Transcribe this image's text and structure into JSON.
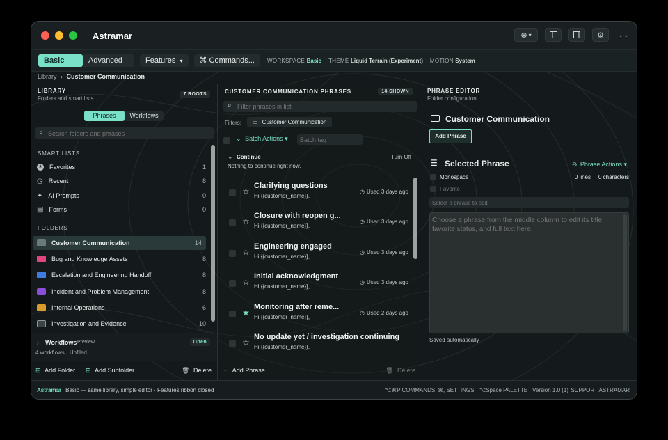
{
  "app": {
    "title": "Astramar"
  },
  "colors": {
    "accent": "#7be0c8",
    "window_bg": "#141a1b",
    "favorite_star": "#7be0c8"
  },
  "ribbon": {
    "modes": [
      "Basic",
      "Advanced"
    ],
    "features_label": "Features",
    "commands_label": "⌘ Commands...",
    "workspace_key": "WORKSPACE",
    "workspace_val": "Basic",
    "theme_key": "THEME",
    "theme_val": "Liquid Terrain (Experiment)",
    "motion_key": "MOTION",
    "motion_val": "System"
  },
  "breadcrumb": {
    "root": "Library",
    "sep": "›",
    "current": "Customer Communication"
  },
  "library": {
    "title": "LIBRARY",
    "subtitle": "Folders and smart lists",
    "roots_badge": "7 ROOTS",
    "tabs": [
      "Phrases",
      "Workflows"
    ],
    "search_placeholder": "Search folders and phrases",
    "smart_lists_title": "SMART LISTS",
    "smart_lists": [
      {
        "label": "Favorites",
        "count": "1",
        "icon": "star-circle-icon"
      },
      {
        "label": "Recent",
        "count": "8",
        "icon": "clock-icon"
      },
      {
        "label": "AI Prompts",
        "count": "0",
        "icon": "sparkle-icon"
      },
      {
        "label": "Forms",
        "count": "0",
        "icon": "form-icon"
      }
    ],
    "folders_title": "FOLDERS",
    "folders": [
      {
        "label": "Customer Communication",
        "count": "14",
        "color": "#6b7a7c"
      },
      {
        "label": "Bug and Knowledge Assets",
        "count": "8",
        "color": "#e0457b"
      },
      {
        "label": "Escalation and Engineering Handoff",
        "count": "8",
        "color": "#3f7be0"
      },
      {
        "label": "Incident and Problem Management",
        "count": "8",
        "color": "#8a4fd6"
      },
      {
        "label": "Internal Operations",
        "count": "6",
        "color": "#d99a2b"
      },
      {
        "label": "Investigation and Evidence",
        "count": "10",
        "color": "#3a4445"
      }
    ],
    "workflows_label": "Workflows",
    "workflows_tag": "Preview",
    "workflows_badge": "Open",
    "workflows_meta": "4 workflows · Unfiled",
    "add_folder": "Add Folder",
    "add_subfolder": "Add Subfolder",
    "delete": "Delete"
  },
  "phrases": {
    "title": "CUSTOMER COMMUNICATION PHRASES",
    "shown_badge": "14 SHOWN",
    "filter_placeholder": "Filter phrases in list",
    "filters_label": "Filters:",
    "filter_chip": "Customer Communication",
    "batch_actions": "Batch Actions",
    "batch_tag_placeholder": "Batch tag",
    "continue_title": "Continue",
    "turn_off": "Turn Off",
    "continue_empty": "Nothing to continue right now.",
    "items": [
      {
        "title": "Clarifying questions",
        "sub": "Hi {{customer_name}},",
        "used": "Used 3 days ago",
        "fav": false
      },
      {
        "title": "Closure with reopen g...",
        "sub": "Hi {{customer_name}},",
        "used": "Used 3 days ago",
        "fav": false
      },
      {
        "title": "Engineering engaged",
        "sub": "Hi {{customer_name}},",
        "used": "Used 3 days ago",
        "fav": false
      },
      {
        "title": "Initial acknowledgment",
        "sub": "Hi {{customer_name}},",
        "used": "Used 3 days ago",
        "fav": false
      },
      {
        "title": "Monitoring after reme...",
        "sub": "Hi {{customer_name}},",
        "used": "Used 2 days ago",
        "fav": true
      },
      {
        "title": "No update yet / investigation continuing",
        "sub": "Hi {{customer_name}},",
        "used": "",
        "fav": false
      }
    ],
    "add_phrase": "Add Phrase",
    "delete": "Delete"
  },
  "editor": {
    "title": "PHRASE EDITOR",
    "subtitle": "Folder configuration",
    "folder_name": "Customer Communication",
    "add_phrase": "Add Phrase",
    "selected_title": "Selected Phrase",
    "phrase_actions": "Phrase Actions",
    "monospace": "Monospace",
    "favorite": "Favorite",
    "lines": "0 lines",
    "characters": "0 characters",
    "title_placeholder": "Select a phrase to edit",
    "body_placeholder": "Choose a phrase from the middle column to edit its title, favorite status, and full text here.",
    "saved": "Saved automatically"
  },
  "status": {
    "app": "Astramar",
    "desc": "Basic — same library, simple editor · Features ribbon closed",
    "commands": "⌥⌘P COMMANDS",
    "settings": "⌘, SETTINGS",
    "palette": "⌥Space PALETTE",
    "version": "Version 1.0 (1)",
    "support": "SUPPORT ASTRAMAR"
  }
}
